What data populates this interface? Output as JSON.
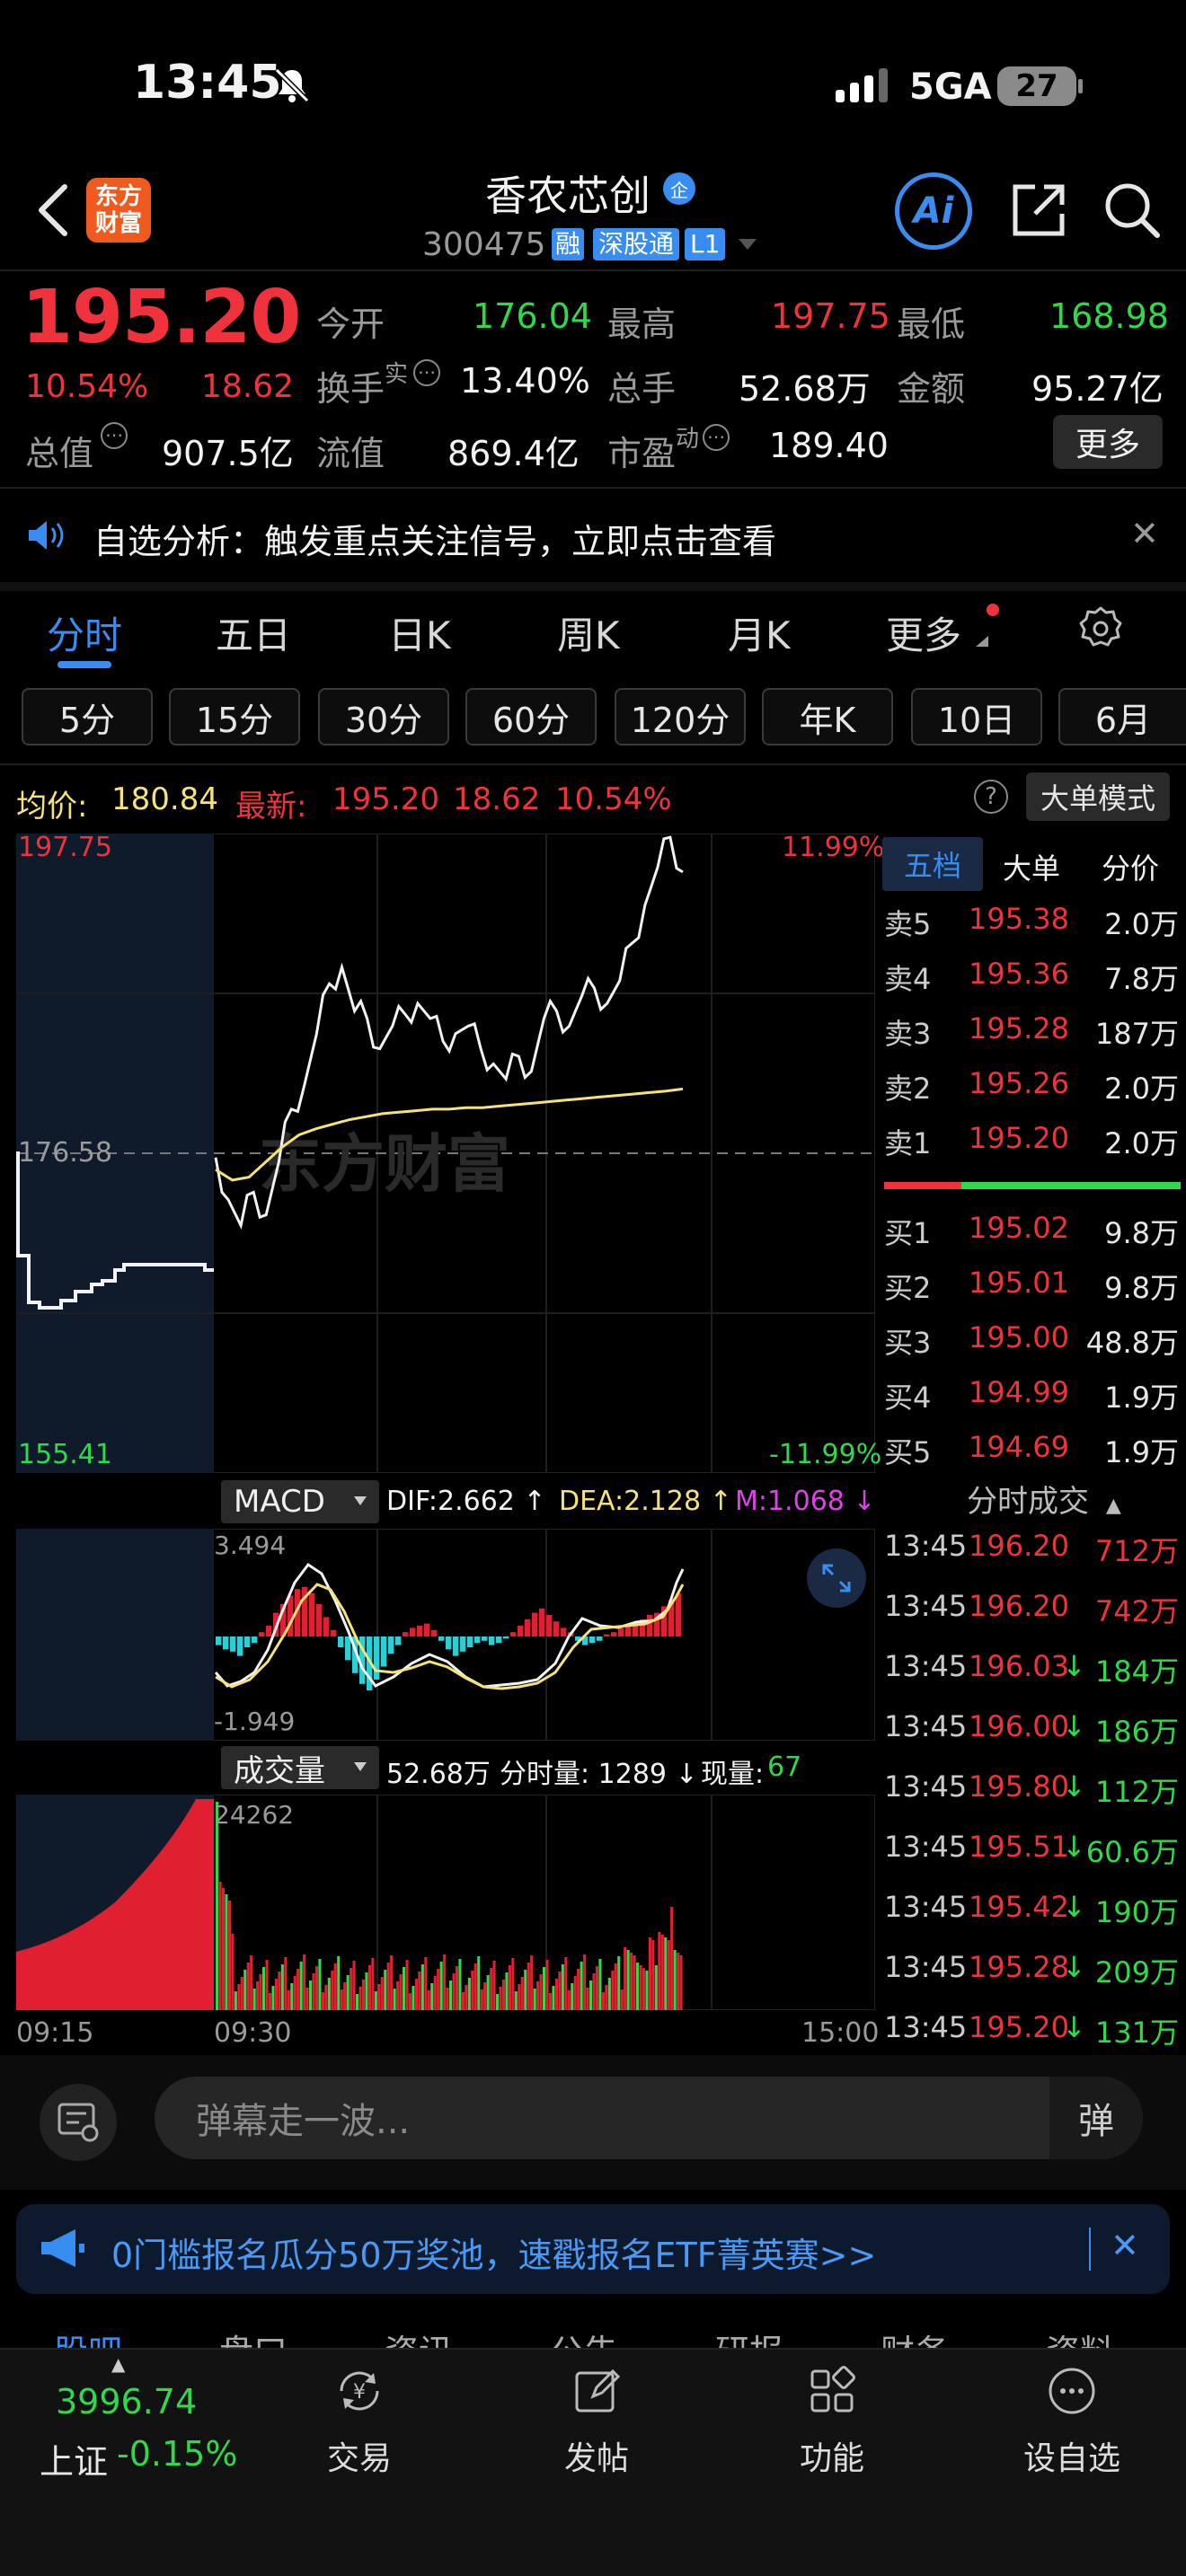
{
  "status_bar": {
    "time": "13:45",
    "network": "5GA",
    "battery": "27"
  },
  "header": {
    "title": "香农芯创",
    "title_badge": "企",
    "code": "300475",
    "tags": [
      "融",
      "深股通",
      "L1"
    ],
    "logo_line1": "东方",
    "logo_line2": "财富",
    "ai_label": "Ai"
  },
  "quote": {
    "price": "195.20",
    "change_pct": "10.54%",
    "change": "18.62",
    "open_label": "今开",
    "open": "176.04",
    "high_label": "最高",
    "high": "197.75",
    "low_label": "最低",
    "low": "168.98",
    "turnover_label": "换手",
    "turnover_sup": "实",
    "turnover": "13.40%",
    "volume_label": "总手",
    "volume": "52.68万",
    "amount_label": "金额",
    "amount": "95.27亿",
    "mktcap_label": "总值",
    "mktcap": "907.5亿",
    "float_label": "流值",
    "float": "869.4亿",
    "pe_label": "市盈",
    "pe_sup": "动",
    "pe": "189.40",
    "more_button": "更多"
  },
  "notice": {
    "text": "自选分析：触发重点关注信号，立即点击查看"
  },
  "period_tabs": [
    "分时",
    "五日",
    "日K",
    "周K",
    "月K",
    "更多"
  ],
  "active_tab": "分时",
  "minute_tabs": [
    "5分",
    "15分",
    "30分",
    "60分",
    "120分",
    "年K",
    "10日",
    "6月"
  ],
  "info_line": {
    "avg_label": "均价:",
    "avg": "180.84",
    "latest_label": "最新:",
    "latest": "195.20",
    "latest_chg": "18.62",
    "latest_pct": "10.54%",
    "big_order_mode": "大单模式"
  },
  "chart_labels": {
    "y_max": "197.75",
    "y_ref": "176.58",
    "y_min": "155.41",
    "pct_max": "11.99%",
    "pct_min": "-11.99%",
    "watermark": "东方财富",
    "macd_label": "MACD",
    "dif": "DIF:2.662 ↑",
    "dea": "DEA:2.128 ↑",
    "m": "M:1.068 ↓",
    "macd_max": "3.494",
    "macd_min": "-1.949",
    "vol_label": "成交量",
    "vol_total": "52.68万",
    "vol_minute": "分时量: 1289 ↓",
    "vol_now_label": "现量:",
    "vol_now": "67",
    "vol_max": "24262",
    "x_start": "09:15",
    "x_open": "09:30",
    "x_end": "15:00"
  },
  "chart_data": {
    "type": "line",
    "series": [
      {
        "name": "最新",
        "values": [
          176.3,
          173.5,
          171.8,
          174.0,
          172.5,
          176.0,
          179.5,
          181.0,
          184.5,
          187.8,
          188.9,
          186.0,
          185.5,
          183.5,
          185.0,
          185.8,
          186.5,
          185.5,
          184.0,
          184.5,
          185.0,
          183.5,
          182.5,
          181.5,
          183.0,
          182.0,
          185.5,
          186.0,
          185.0,
          187.0,
          187.5,
          186.5,
          188.0,
          190.5,
          193.0,
          195.5,
          197.5,
          195.2
        ]
      },
      {
        "name": "均价",
        "values": [
          175.5,
          174.8,
          175.0,
          176.0,
          177.0,
          177.8,
          178.2,
          178.5,
          178.8,
          179.0,
          179.2,
          179.3,
          179.4,
          179.5,
          179.5,
          179.6,
          179.6,
          179.7,
          179.8,
          179.9,
          180.0,
          180.1,
          180.2,
          180.3,
          180.4,
          180.5,
          180.6,
          180.7,
          180.84
        ]
      }
    ],
    "ylim": [
      155.41,
      197.75
    ]
  },
  "order_book": {
    "tabs": [
      "五档",
      "大单",
      "分价"
    ],
    "asks": [
      {
        "label": "卖5",
        "price": "195.38",
        "vol": "2.0万"
      },
      {
        "label": "卖4",
        "price": "195.36",
        "vol": "7.8万"
      },
      {
        "label": "卖3",
        "price": "195.28",
        "vol": "187万"
      },
      {
        "label": "卖2",
        "price": "195.26",
        "vol": "2.0万"
      },
      {
        "label": "卖1",
        "price": "195.20",
        "vol": "2.0万"
      }
    ],
    "bids": [
      {
        "label": "买1",
        "price": "195.02",
        "vol": "9.8万"
      },
      {
        "label": "买2",
        "price": "195.01",
        "vol": "9.8万"
      },
      {
        "label": "买3",
        "price": "195.00",
        "vol": "48.8万"
      },
      {
        "label": "买4",
        "price": "194.99",
        "vol": "1.9万"
      },
      {
        "label": "买5",
        "price": "194.69",
        "vol": "1.9万"
      }
    ],
    "trades_title": "分时成交",
    "trades": [
      {
        "time": "13:45",
        "price": "196.20",
        "dir": "",
        "vol": "712万",
        "color": "red"
      },
      {
        "time": "13:45",
        "price": "196.20",
        "dir": "",
        "vol": "742万",
        "color": "red"
      },
      {
        "time": "13:45",
        "price": "196.03",
        "dir": "↓",
        "vol": "184万",
        "color": "green"
      },
      {
        "time": "13:45",
        "price": "196.00",
        "dir": "↓",
        "vol": "186万",
        "color": "green"
      },
      {
        "time": "13:45",
        "price": "195.80",
        "dir": "↓",
        "vol": "112万",
        "color": "green"
      },
      {
        "time": "13:45",
        "price": "195.51",
        "dir": "↓",
        "vol": "60.6万",
        "color": "green"
      },
      {
        "time": "13:45",
        "price": "195.42",
        "dir": "↓",
        "vol": "190万",
        "color": "green"
      },
      {
        "time": "13:45",
        "price": "195.28",
        "dir": "↓",
        "vol": "209万",
        "color": "green"
      },
      {
        "time": "13:45",
        "price": "195.20",
        "dir": "↓",
        "vol": "131万",
        "color": "green"
      }
    ]
  },
  "comment_bar": {
    "placeholder": "弹幕走一波...",
    "danmu_label": "弹"
  },
  "banner": {
    "text": "0门槛报名瓜分50万奖池，速戳报名ETF菁英赛>>"
  },
  "peek_tabs": [
    "股吧",
    "盘口",
    "资讯",
    "公告",
    "研报",
    "财务",
    "资料"
  ],
  "bottom_nav": {
    "index_value": "3996.74",
    "index_name": "上证",
    "index_change": "-0.15%",
    "items": [
      "交易",
      "发帖",
      "功能",
      "设自选"
    ]
  },
  "colors": {
    "up": "#f0323c",
    "down": "#2fd94a",
    "accent": "#3a8df0",
    "avg_line": "#f5e27a"
  }
}
